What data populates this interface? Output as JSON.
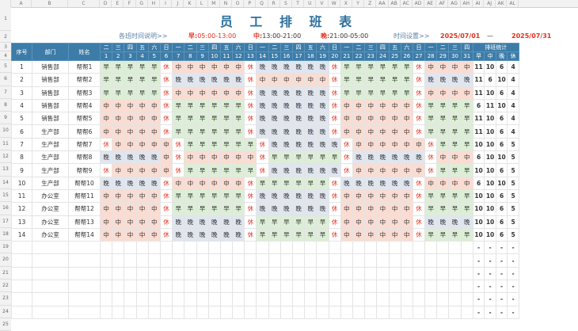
{
  "title": "员 工 排 班 表",
  "info": {
    "desc_label": "各班时间说明>>",
    "early_label": "早:",
    "early_time": "05:00-13:00",
    "mid_label": "中:",
    "mid_time": "13:00-21:00",
    "night_label": "晚:",
    "night_time": "21:00-05:00",
    "setting_label": "时间设置>>",
    "start_date": "2025/07/01",
    "dash": "—",
    "end_date": "2025/07/31"
  },
  "columns": [
    "A",
    "B",
    "C",
    "D",
    "E",
    "F",
    "G",
    "H",
    "I",
    "J",
    "K",
    "L",
    "M",
    "N",
    "O",
    "P",
    "Q",
    "R",
    "S",
    "T",
    "U",
    "V",
    "W",
    "X",
    "Y",
    "Z",
    "AA",
    "AB",
    "AC",
    "AD",
    "AE",
    "AF",
    "AG",
    "AH",
    "AI",
    "AJ",
    "AK",
    "AL"
  ],
  "row_numbers": [
    "1",
    "2",
    "3",
    "4",
    "5",
    "6",
    "7",
    "8",
    "9",
    "10",
    "11",
    "12",
    "13",
    "14",
    "15",
    "16",
    "17",
    "18",
    "19",
    "20",
    "21",
    "22",
    "23",
    "24",
    "25"
  ],
  "headers": {
    "index": "序号",
    "dept": "部门",
    "name": "姓名",
    "stats": "排班统计"
  },
  "weekdays": [
    "二",
    "三",
    "四",
    "五",
    "六",
    "日",
    "一",
    "二",
    "三",
    "四",
    "五",
    "六",
    "日",
    "一",
    "二",
    "三",
    "四",
    "五",
    "六",
    "日",
    "一",
    "二",
    "三",
    "四",
    "五",
    "六",
    "日",
    "一",
    "二",
    "三",
    "四"
  ],
  "days": [
    "1",
    "2",
    "3",
    "4",
    "5",
    "6",
    "7",
    "8",
    "9",
    "10",
    "11",
    "12",
    "13",
    "14",
    "15",
    "16",
    "17",
    "18",
    "19",
    "20",
    "21",
    "22",
    "23",
    "24",
    "25",
    "26",
    "27",
    "28",
    "29",
    "30",
    "31"
  ],
  "stat_headers": [
    "早",
    "中",
    "晚",
    "休"
  ],
  "employees": [
    {
      "no": "1",
      "dept": "销售部",
      "name": "帮帮1",
      "s": "早早早早早休中中中中中中休晚晚晚晚晚晚休早早早早早早休中中中中",
      "stats": [
        "11",
        "10",
        "6",
        "4"
      ]
    },
    {
      "no": "2",
      "dept": "销售部",
      "name": "帮帮2",
      "s": "早早早早早休晚晚晚晚晚晚休中中中中中中休早早早早早早休晚晚晚晚",
      "stats": [
        "11",
        "6",
        "10",
        "4"
      ]
    },
    {
      "no": "3",
      "dept": "销售部",
      "name": "帮帮3",
      "s": "早早早早早休中中中中中中休晚晚晚晚晚晚休早早早早早早休中中中中",
      "stats": [
        "11",
        "10",
        "6",
        "4"
      ]
    },
    {
      "no": "4",
      "dept": "销售部",
      "name": "帮帮4",
      "s": "中中中中中休早早早早早早休晚晚晚晚晚晚休中中中中中中休早早早早",
      "stats": [
        "6",
        "11",
        "10",
        "4"
      ]
    },
    {
      "no": "5",
      "dept": "销售部",
      "name": "帮帮5",
      "s": "中中中中中休早早早早早早休晚晚晚晚晚晚休中中中中中中休早早早早",
      "stats": [
        "11",
        "10",
        "6",
        "4"
      ]
    },
    {
      "no": "6",
      "dept": "生产部",
      "name": "帮帮6",
      "s": "中中中中中休早早早早早早休晚晚晚晚晚晚休中中中中中中休早早早早",
      "stats": [
        "11",
        "10",
        "6",
        "4"
      ]
    },
    {
      "no": "7",
      "dept": "生产部",
      "name": "帮帮7",
      "s": "休中中中中中休早早早早早早休晚晚晚晚晚晚休中中中中中中休早早早",
      "stats": [
        "10",
        "10",
        "6",
        "5"
      ]
    },
    {
      "no": "8",
      "dept": "生产部",
      "name": "帮帮8",
      "s": "晚晚晚晚晚中休中中中中中中休早早早早早早休晚晚晚晚晚晚休中中中",
      "stats": [
        "6",
        "10",
        "10",
        "5"
      ]
    },
    {
      "no": "9",
      "dept": "生产部",
      "name": "帮帮9",
      "s": "休中中中中中休早早早早早早休晚晚晚晚晚晚休中中中中中中休早早早",
      "stats": [
        "10",
        "10",
        "6",
        "5"
      ]
    },
    {
      "no": "10",
      "dept": "生产部",
      "name": "帮帮10",
      "s": "晚晚晚晚晚休中中中中中中休早早早早早早休晚晚晚晚晚晚休中中中中",
      "stats": [
        "6",
        "10",
        "10",
        "5"
      ]
    },
    {
      "no": "11",
      "dept": "办公室",
      "name": "帮帮11",
      "s": "中中中中中休早早早早早早休晚晚晚晚晚晚休中中中中中中休早早早早",
      "stats": [
        "10",
        "10",
        "6",
        "5"
      ]
    },
    {
      "no": "12",
      "dept": "办公室",
      "name": "帮帮12",
      "s": "中中中中中休早早早早早早休晚晚晚晚晚晚休中中中中中中休早早早早",
      "stats": [
        "10",
        "10",
        "6",
        "5"
      ]
    },
    {
      "no": "13",
      "dept": "办公室",
      "name": "帮帮13",
      "s": "中中中中中休晚晚晚晚晚晚休早早早早早早休中中中中中中休晚晚晚晚",
      "stats": [
        "10",
        "10",
        "6",
        "5"
      ]
    },
    {
      "no": "14",
      "dept": "办公室",
      "name": "帮帮14",
      "s": "中中中中中休晚晚晚晚晚晚休早早早早早早休中中中中中中休早早早早",
      "stats": [
        "10",
        "10",
        "6",
        "5"
      ]
    }
  ],
  "empty_stat": "-",
  "empty_rows": 6,
  "colors": {
    "header": "#3d7ca8",
    "early": "#dcefd6",
    "mid": "#fbdcd2",
    "night": "#e0e6f0",
    "off_text": "#e0301e",
    "title": "#2c6f9c"
  }
}
